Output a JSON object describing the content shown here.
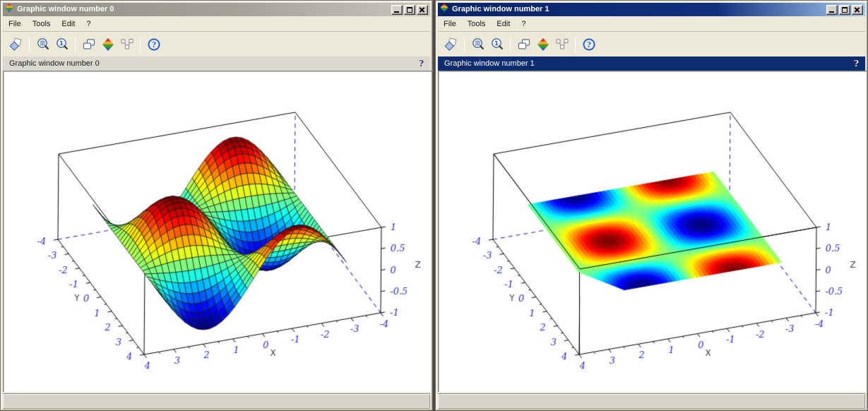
{
  "colors": {
    "active_title_gradient": [
      "#0A246A",
      "#A6CAF0"
    ],
    "inactive_title_gradient": [
      "#928F86",
      "#C9C6BC"
    ],
    "chrome_bg": "#ECE9D8",
    "infobar_active_bg": "#0D2C72",
    "infobar_inactive_bg": "#DBD8CF",
    "plot_bg": "#FFFFFF",
    "axis_line_color": "#000000",
    "tick_label_color": "#2B2BCC",
    "hidden_edge_color": "#2B2BCC",
    "axis_name_color": "#3C3C3C"
  },
  "windows": [
    {
      "title": "Graphic window number 0",
      "active": false,
      "menu": [
        "File",
        "Tools",
        "Edit",
        "?"
      ],
      "window_buttons": [
        "minimize-icon",
        "maximize-icon",
        "close-icon"
      ],
      "toolbar_icons": [
        "rotate-icon",
        "zoom-area-icon",
        "zoom-one-icon",
        "copy-figure-icon",
        "scilab-ged-icon",
        "edit-data-icon",
        "help-icon"
      ],
      "infobar": {
        "text": "Graphic window number 0",
        "help": "?"
      },
      "status": ""
    },
    {
      "title": "Graphic window number 1",
      "active": true,
      "menu": [
        "File",
        "Tools",
        "Edit",
        "?"
      ],
      "window_buttons": [
        "minimize-icon",
        "maximize-icon",
        "close-icon"
      ],
      "toolbar_icons": [
        "rotate-icon",
        "zoom-area-icon",
        "zoom-one-icon",
        "copy-figure-icon",
        "scilab-ged-icon",
        "edit-data-icon",
        "help-icon"
      ],
      "infobar": {
        "text": "Graphic window number 1",
        "help": "?"
      },
      "status": ""
    }
  ],
  "chart_data": [
    {
      "type": "surface",
      "render": "mesh",
      "function": "z = sin(x)*cos(y)",
      "surface_domain": {
        "x": [
          -3.14159,
          3.14159
        ],
        "y": [
          -3.14159,
          3.14159
        ]
      },
      "grid": [
        30,
        30
      ],
      "colormap": "jet",
      "mesh_line_color": "#111111",
      "axis_bounds": {
        "x": [
          -4,
          4
        ],
        "y": [
          -4,
          4
        ],
        "z": [
          -1,
          1
        ]
      },
      "x_ticks": [
        4,
        3,
        2,
        1,
        0,
        -1,
        -2,
        -3,
        -4
      ],
      "y_ticks": [
        -4,
        -3,
        -2,
        -1,
        0,
        1,
        2,
        3,
        4
      ],
      "z_ticks": [
        1,
        0.5,
        0,
        -0.5,
        -1
      ],
      "x_label": "X",
      "y_label": "Y",
      "z_label": "Z"
    },
    {
      "type": "surface",
      "render": "flat-z0",
      "function": "color = sin(x)*cos(y), drawn flat at z = 0",
      "z_plane": 0,
      "surface_domain": {
        "x": [
          -3.14159,
          3.14159
        ],
        "y": [
          -3.14159,
          3.14159
        ]
      },
      "grid": [
        46,
        46
      ],
      "colormap": "jet",
      "axis_bounds": {
        "x": [
          -4,
          4
        ],
        "y": [
          -4,
          4
        ],
        "z": [
          -1,
          1
        ]
      },
      "x_ticks": [
        4,
        3,
        2,
        1,
        0,
        -1,
        -2,
        -3,
        -4
      ],
      "y_ticks": [
        -4,
        -3,
        -2,
        -1,
        0,
        1,
        2,
        3,
        4
      ],
      "z_ticks": [
        1,
        0.5,
        0,
        -0.5,
        -1
      ],
      "x_label": "X",
      "y_label": "Y",
      "z_label": "Z"
    }
  ]
}
